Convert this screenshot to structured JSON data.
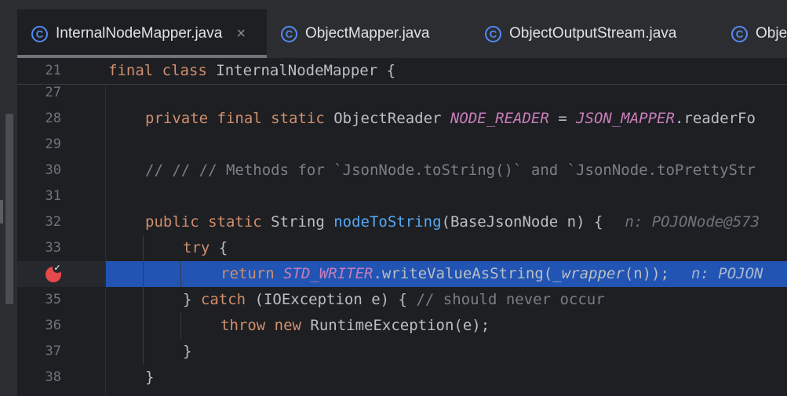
{
  "tabs": [
    {
      "label": "InternalNodeMapper.java",
      "icon": "class-c-icon",
      "active": true,
      "close": "×"
    },
    {
      "label": "ObjectMapper.java",
      "icon": "class-c-icon",
      "active": false
    },
    {
      "label": "ObjectOutputStream.java",
      "icon": "class-c-icon",
      "active": false
    },
    {
      "label": "Obje",
      "icon": "class-c-icon",
      "active": false
    }
  ],
  "tab_icon_glyph": "C",
  "lines": {
    "l21": {
      "num": "21",
      "t1": "final class ",
      "t2": "InternalNodeMapper {"
    },
    "l27": {
      "num": "27"
    },
    "l28": {
      "num": "28",
      "t1": "private final static ",
      "t2": "ObjectReader ",
      "t3": "NODE_READER",
      "t4": " = ",
      "t5": "JSON_MAPPER",
      "t6": ".readerFo"
    },
    "l29": {
      "num": "29"
    },
    "l30": {
      "num": "30",
      "t1": "// // // Methods for `JsonNode.toString()` and `JsonNode.toPrettyStr"
    },
    "l31": {
      "num": "31"
    },
    "l32": {
      "num": "32",
      "t1": "public static ",
      "t2": "String ",
      "t3": "nodeToString",
      "t4": "(BaseJsonNode n) {",
      "hint": "n: POJONode@573"
    },
    "l33": {
      "num": "33",
      "t1": "try",
      "t2": " {"
    },
    "l34": {
      "t1": "return ",
      "t2": "STD_WRITER",
      "t3": ".writeValueAsString(",
      "t4": "_wrapper",
      "t5": "(n));",
      "hint": "n: POJON"
    },
    "l35": {
      "num": "35",
      "t1": "} ",
      "t2": "catch",
      "t3": " (IOException e) { ",
      "t4": "// should never occur"
    },
    "l36": {
      "num": "36",
      "t1": "throw new ",
      "t2": "RuntimeException(e);"
    },
    "l37": {
      "num": "37",
      "t1": "}"
    },
    "l38": {
      "num": "38",
      "t1": "}"
    }
  },
  "breakpoint_check": "✓",
  "colors": {
    "background": "#1e1f22",
    "tabbar": "#2b2d30",
    "keyword": "#cf8e6d",
    "constant": "#c77dbb",
    "function": "#56a8f5",
    "comment": "#7a7e85",
    "execution_line": "#2154b3",
    "breakpoint": "#e5484d"
  }
}
